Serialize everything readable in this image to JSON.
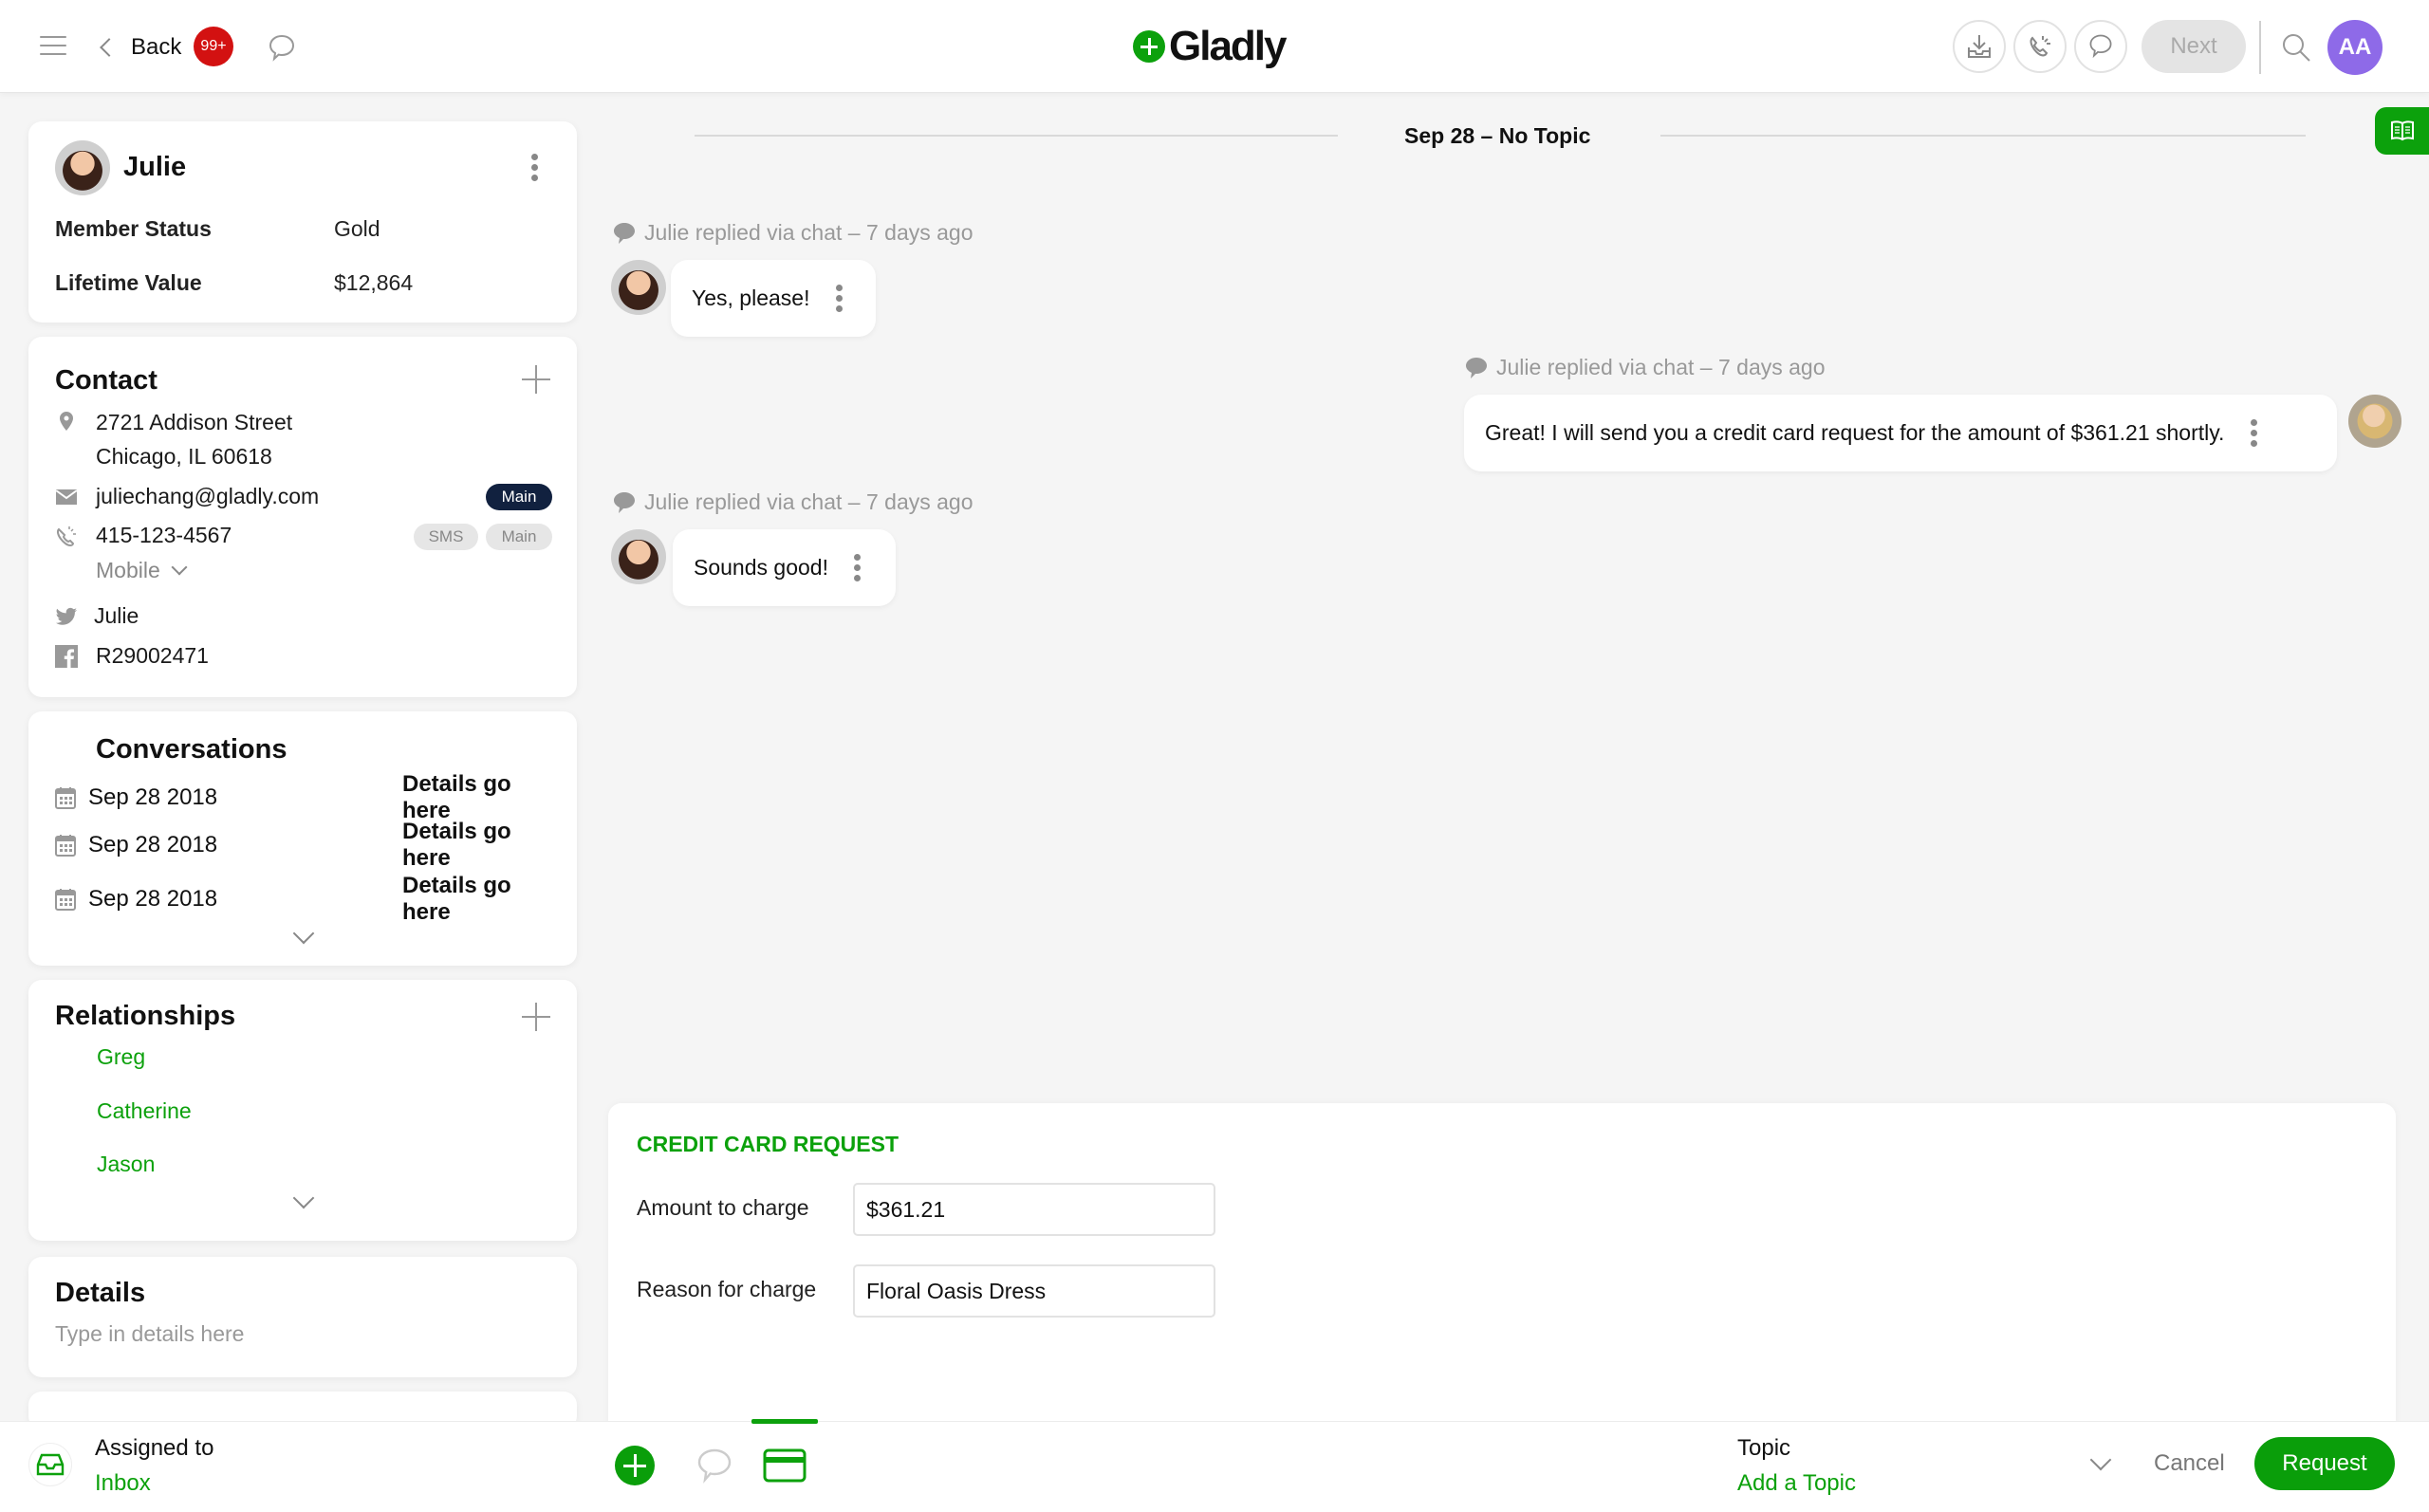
{
  "header": {
    "back_label": "Back",
    "notification_count": "99+",
    "logo_text": "Gladly",
    "next_label": "Next",
    "user_initials": "AA",
    "icons": [
      "menu-icon",
      "chevron-left-icon",
      "chat-bubble-icon",
      "inbox-download-icon",
      "phone-ringing-icon",
      "chat-bubble-icon",
      "search-icon"
    ]
  },
  "customer": {
    "name": "Julie",
    "fields": [
      {
        "label": "Member Status",
        "value": "Gold"
      },
      {
        "label": "Lifetime Value",
        "value": "$12,864"
      }
    ]
  },
  "contact": {
    "title": "Contact",
    "address_line1": "2721 Addison Street",
    "address_line2": "Chicago, IL 60618",
    "email": "juliechang@gladly.com",
    "email_badge": "Main",
    "phone": "415-123-4567",
    "phone_badges": [
      "SMS",
      "Main"
    ],
    "phone_type": "Mobile",
    "twitter": "Julie",
    "facebook": "R29002471"
  },
  "conversations": {
    "title": "Conversations",
    "items": [
      {
        "date": "Sep 28 2018",
        "details": "Details go here"
      },
      {
        "date": "Sep 28 2018",
        "details": "Details go here"
      },
      {
        "date": "Sep 28 2018",
        "details": "Details go here"
      }
    ]
  },
  "relationships": {
    "title": "Relationships",
    "items": [
      "Greg",
      "Catherine",
      "Jason"
    ]
  },
  "details": {
    "title": "Details",
    "placeholder": "Type in details here"
  },
  "timeline": {
    "date_separator": "Sep 28 – No Topic",
    "messages": [
      {
        "meta": "Julie replied via chat – 7 days ago",
        "text": "Yes, please!",
        "side": "customer"
      },
      {
        "meta": "Julie replied via chat – 7 days ago",
        "text": "Great! I will send you a credit card request for the amount of $361.21 shortly.",
        "side": "agent"
      },
      {
        "meta": "Julie replied via chat – 7 days ago",
        "text": "Sounds good!",
        "side": "customer"
      }
    ]
  },
  "credit_card_request": {
    "title": "CREDIT CARD REQUEST",
    "amount_label": "Amount to charge",
    "amount_value": "$361.21",
    "reason_label": "Reason for charge",
    "reason_value": "Floral Oasis Dress"
  },
  "footer": {
    "assigned_label": "Assigned to",
    "assigned_value": "Inbox",
    "topic_label": "Topic",
    "topic_value": "Add a Topic",
    "cancel_label": "Cancel",
    "request_label": "Request"
  },
  "colors": {
    "brand_green": "#0ca10c",
    "badge_red": "#d31111",
    "avatar_purple": "#8e6ae8",
    "main_badge_navy": "#11213f"
  }
}
